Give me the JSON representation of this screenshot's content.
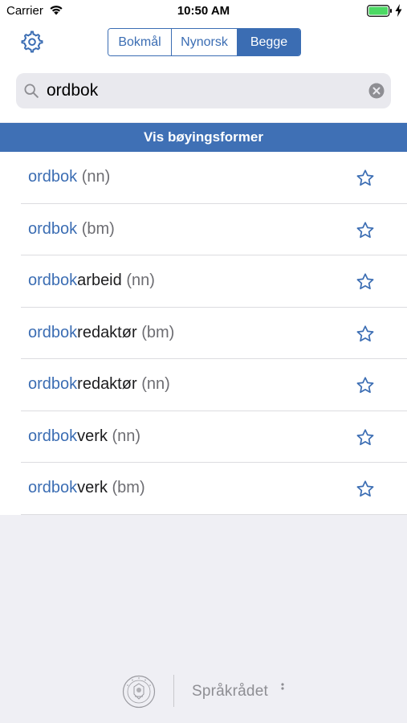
{
  "status_bar": {
    "carrier": "Carrier",
    "time": "10:50 AM"
  },
  "nav": {
    "segments": [
      {
        "label": "Bokmål",
        "active": false
      },
      {
        "label": "Nynorsk",
        "active": false
      },
      {
        "label": "Begge",
        "active": true
      }
    ]
  },
  "search": {
    "value": "ordbok"
  },
  "banner": {
    "label": "Vis bøyingsformer"
  },
  "results": [
    {
      "match": "ordbok",
      "rest": "",
      "tag": "(nn)"
    },
    {
      "match": "ordbok",
      "rest": "",
      "tag": "(bm)"
    },
    {
      "match": "ordbok",
      "rest": "arbeid",
      "tag": "(nn)"
    },
    {
      "match": "ordbok",
      "rest": "redaktør",
      "tag": "(bm)"
    },
    {
      "match": "ordbok",
      "rest": "redaktør",
      "tag": "(nn)"
    },
    {
      "match": "ordbok",
      "rest": "verk",
      "tag": "(nn)"
    },
    {
      "match": "ordbok",
      "rest": "verk",
      "tag": "(bm)"
    }
  ],
  "footer": {
    "sprakradet_logo_text": "Språkrådet"
  },
  "colors": {
    "accent": "#3b6db3",
    "banner": "#3f70b5",
    "background": "#efeff4",
    "battery": "#4cd964"
  },
  "icons": [
    "wifi-icon",
    "battery-icon",
    "gear-icon",
    "search-icon",
    "clear-icon",
    "star-icon"
  ]
}
